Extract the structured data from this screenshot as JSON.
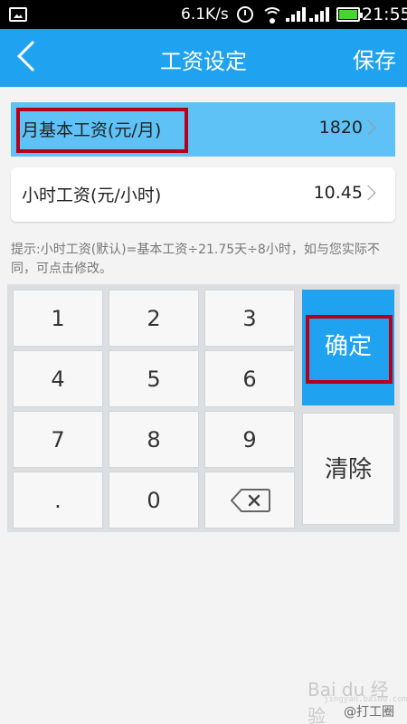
{
  "status_bar": {
    "speed": "6.1K/s",
    "time": "21:55"
  },
  "header": {
    "title": "工资设定",
    "save_label": "保存"
  },
  "rows": {
    "monthly": {
      "label": "月基本工资(元/月)",
      "value": "1820"
    },
    "hourly": {
      "label": "小时工资(元/小时)",
      "value": "10.45"
    }
  },
  "hint": "提示:小时工资(默认)=基本工资÷21.75天÷8小时，如与您实际不同，可点击修改。",
  "keypad": {
    "keys": [
      "1",
      "2",
      "3",
      "4",
      "5",
      "6",
      "7",
      "8",
      "9",
      ".",
      "0"
    ],
    "confirm_label": "确定",
    "clear_label": "清除"
  },
  "watermark": {
    "brand": "Bai du 经验",
    "sub": "jingyan.baidu.com",
    "user": "@打工圈"
  },
  "colors": {
    "accent": "#1fa2ef",
    "highlight_row": "#5fc2f6",
    "annotation_border": "#b5001c"
  },
  "icons": {
    "back": "chevron-left-icon",
    "arrow": "chevron-right-icon",
    "backspace": "backspace-icon"
  }
}
